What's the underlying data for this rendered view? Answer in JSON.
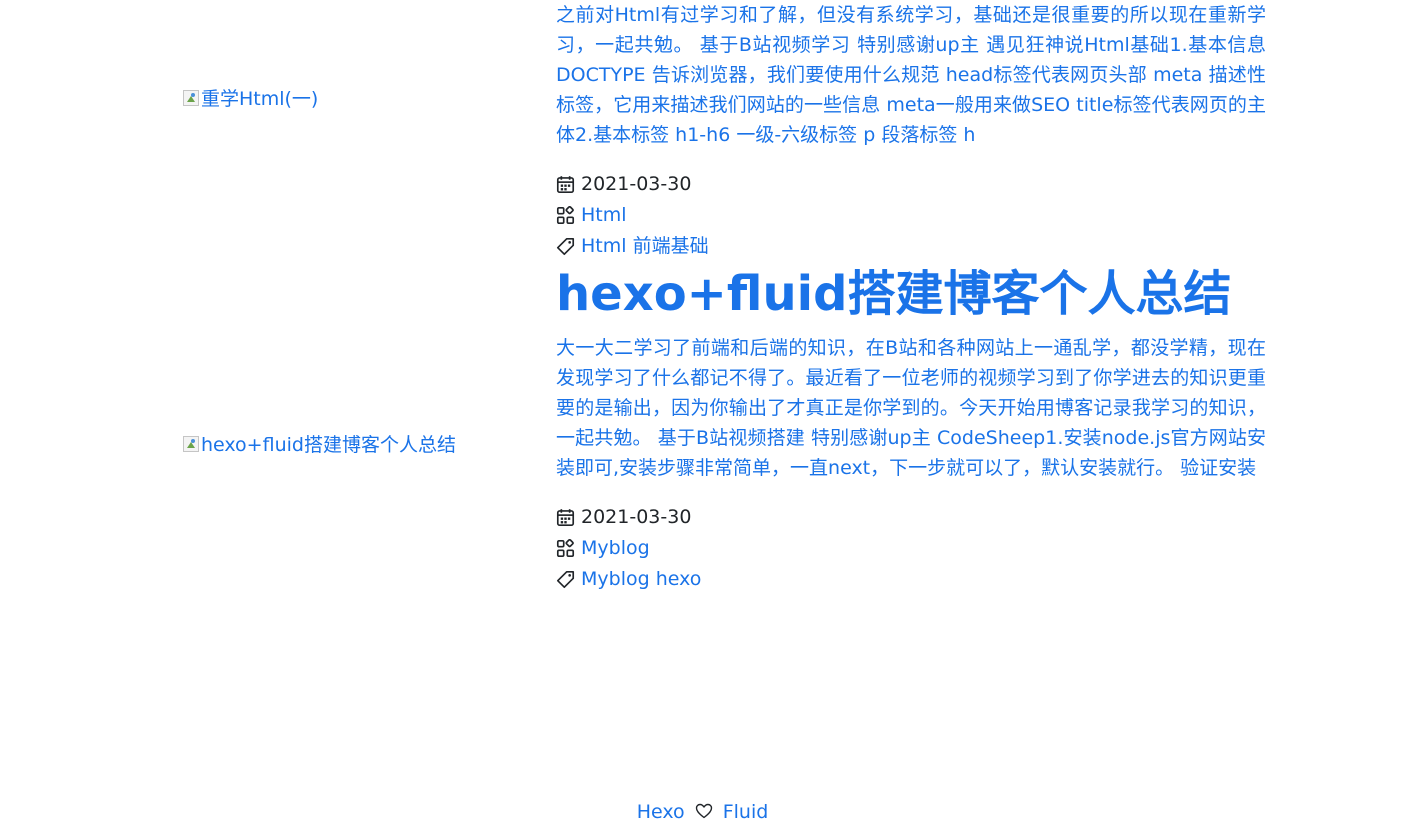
{
  "posts": [
    {
      "thumb_alt": "重学Html(一)",
      "excerpt": "之前对Html有过学习和了解，但没有系统学习，基础还是很重要的所以现在重新学习，一起共勉。 基于B站视频学习 特别感谢up主 遇见狂神说Html基础1.基本信息 DOCTYPE 告诉浏览器，我们要使用什么规范 head标签代表网页头部 meta 描述性标签，它用来描述我们网站的一些信息 meta一般用来做SEO title标签代表网页的主体2.基本标签 h1-h6 一级-六级标签 p 段落标签 h",
      "date": "2021-03-30",
      "category": "Html",
      "tags": "Html 前端基础"
    },
    {
      "title": "hexo+fluid搭建博客个人总结",
      "thumb_alt": "hexo+fluid搭建博客个人总结",
      "excerpt": "大一大二学习了前端和后端的知识，在B站和各种网站上一通乱学，都没学精，现在发现学习了什么都记不得了。最近看了一位老师的视频学习到了你学进去的知识更重要的是输出，因为你输出了才真正是你学到的。今天开始用博客记录我学习的知识，一起共勉。 基于B站视频搭建 特别感谢up主 CodeSheep1.安装node.js官方网站安装即可,安装步骤非常简单，一直next，下一步就可以了，默认安装就行。 验证安装",
      "date": "2021-03-30",
      "category": "Myblog",
      "tags": "Myblog hexo"
    }
  ],
  "footer": {
    "hexo": "Hexo",
    "fluid": "Fluid"
  },
  "icons": {
    "date": "calendar-icon",
    "category": "category-icon",
    "tag": "tag-icon",
    "footer": "heart-icon"
  },
  "colors": {
    "link": "#1a73e8",
    "text": "#212529"
  }
}
